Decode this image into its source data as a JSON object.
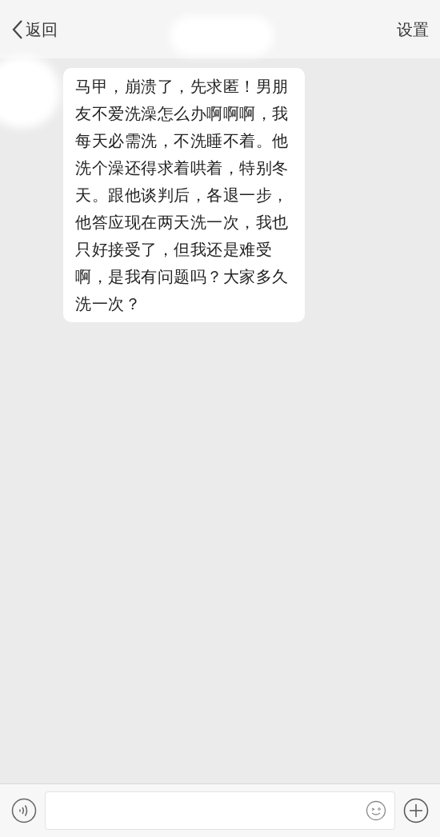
{
  "header": {
    "back_label": "返回",
    "settings_label": "设置"
  },
  "messages": [
    {
      "text": "马甲，崩溃了，先求匿！男朋友不爱洗澡怎么办啊啊啊，我每天必需洗，不洗睡不着。他洗个澡还得求着哄着，特别冬天。跟他谈判后，各退一步，他答应现在两天洗一次，我也只好接受了，但我还是难受啊，是我有问题吗？大家多久洗一次？"
    }
  ]
}
